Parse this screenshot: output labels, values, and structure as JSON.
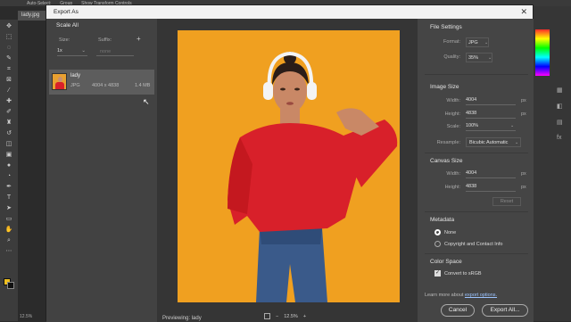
{
  "photoshop": {
    "options_bar": [
      "Auto-Select:",
      "Group",
      "Show Transform Controls"
    ],
    "doc_tab": "lady.jpg",
    "zoom_status": "12.5%"
  },
  "dialog": {
    "title": "Export As",
    "left": {
      "scale_all_label": "Scale All",
      "size_label": "Size:",
      "suffix_label": "Suffix:",
      "size_value": "1x",
      "suffix_placeholder": "none",
      "file": {
        "name": "lady",
        "format": "JPG",
        "dimensions": "4004 x 4838",
        "size": "1.4 MB"
      }
    },
    "preview": {
      "label": "Previewing: lady",
      "zoom": "12.5%"
    },
    "file_settings": {
      "title": "File Settings",
      "format_label": "Format:",
      "format_value": "JPG",
      "quality_label": "Quality:",
      "quality_value": "35%"
    },
    "image_size": {
      "title": "Image Size",
      "width_label": "Width:",
      "width_value": "4004",
      "height_label": "Height:",
      "height_value": "4838",
      "scale_label": "Scale:",
      "scale_value": "100%",
      "resample_label": "Resample:",
      "resample_value": "Bicubic Automatic",
      "unit": "px"
    },
    "canvas_size": {
      "title": "Canvas Size",
      "width_label": "Width:",
      "width_value": "4004",
      "height_label": "Height:",
      "height_value": "4838",
      "reset_label": "Reset",
      "unit": "px"
    },
    "metadata": {
      "title": "Metadata",
      "options": [
        "None",
        "Copyright and Contact Info"
      ],
      "selected": "None"
    },
    "color_space": {
      "title": "Color Space",
      "convert_label": "Convert to sRGB",
      "checked": true
    },
    "learn_more_prefix": "Learn more about",
    "learn_more_link": "export options.",
    "cancel_label": "Cancel",
    "export_label": "Export All..."
  },
  "colors": {
    "photo_background": "#f0a020",
    "sweater": "#d8202a",
    "jeans": "#3a5a8a"
  }
}
